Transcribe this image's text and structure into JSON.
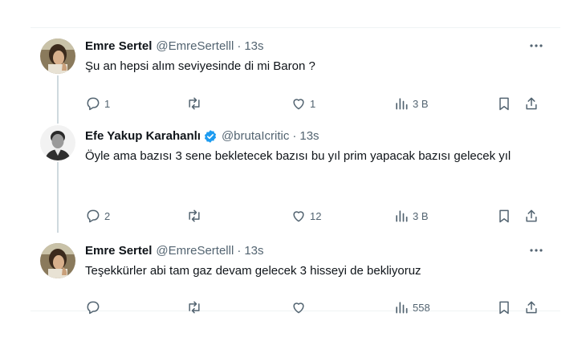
{
  "tweets": [
    {
      "name": "Emre Sertel",
      "handle": "@EmreSertelll",
      "separator": "·",
      "time": "13s",
      "text": "Şu an hepsi alım seviyesinde di mi Baron ?",
      "replies": "1",
      "retweets": "",
      "likes": "1",
      "views": "3 B",
      "verified": false
    },
    {
      "name": "Efe Yakup Karahanlı",
      "handle": "@brutaIcritic",
      "separator": "·",
      "time": "13s",
      "text": "Öyle ama bazısı 3 sene bekletecek bazısı bu yıl prim yapacak bazısı gelecek yıl",
      "replies": "2",
      "retweets": "",
      "likes": "12",
      "views": "3 B",
      "verified": true,
      "verified_color": "#1d9bf0"
    },
    {
      "name": "Emre Sertel",
      "handle": "@EmreSertelll",
      "separator": "·",
      "time": "13s",
      "text": "Teşekkürler abi tam gaz devam gelecek 3 hisseyi de bekliyoruz",
      "replies": "",
      "retweets": "",
      "likes": "",
      "views": "558",
      "verified": false
    }
  ],
  "icons": {
    "reply": "reply-icon",
    "retweet": "retweet-icon",
    "like": "heart-icon",
    "views": "views-icon",
    "bookmark": "bookmark-icon",
    "share": "share-icon",
    "more": "more-icon"
  },
  "colors": {
    "text": "#0f1419",
    "muted": "#536471",
    "line": "#cfd9de",
    "verified": "#1d9bf0"
  }
}
